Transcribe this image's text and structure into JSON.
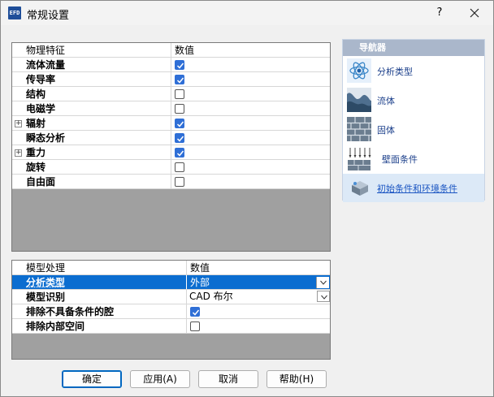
{
  "window": {
    "title": "常规设置",
    "app_icon_text": "EFD",
    "help_label": "?"
  },
  "physical_grid": {
    "col_feature": "物理特征",
    "col_value": "数值",
    "rows": [
      {
        "label": "流体流量",
        "checked": true,
        "expandable": false
      },
      {
        "label": "传导率",
        "checked": true,
        "expandable": false
      },
      {
        "label": "结构",
        "checked": false,
        "expandable": false
      },
      {
        "label": "电磁学",
        "checked": false,
        "expandable": false
      },
      {
        "label": "辐射",
        "checked": true,
        "expandable": true
      },
      {
        "label": "瞬态分析",
        "checked": true,
        "expandable": false
      },
      {
        "label": "重力",
        "checked": true,
        "expandable": true
      },
      {
        "label": "旋转",
        "checked": false,
        "expandable": false
      },
      {
        "label": "自由面",
        "checked": false,
        "expandable": false
      }
    ]
  },
  "model_grid": {
    "col_feature": "模型处理",
    "col_value": "数值",
    "analysis_type": {
      "label": "分析类型",
      "value": "外部"
    },
    "model_recognition": {
      "label": "模型识别",
      "value": "CAD 布尔"
    },
    "exclude_cavities": {
      "label": "排除不具备条件的腔",
      "checked": true
    },
    "exclude_internal": {
      "label": "排除内部空间",
      "checked": false
    }
  },
  "navigator": {
    "title": "导航器",
    "items": [
      {
        "label": "分析类型",
        "icon": "atom-icon"
      },
      {
        "label": "流体",
        "icon": "fluid-wave-icon"
      },
      {
        "label": "固体",
        "icon": "solid-brick-icon"
      },
      {
        "label": "壁面条件",
        "icon": "wall-condition-icon"
      },
      {
        "label": "初始条件和环境条件",
        "icon": "initial-conditions-icon"
      }
    ]
  },
  "buttons": {
    "ok": "确定",
    "apply": "应用(A)",
    "cancel": "取消",
    "help": "帮助(H)"
  },
  "colors": {
    "selection": "#0b6dd0",
    "checkbox_on": "#2f6fd6",
    "navigator_header": "#aab7cb"
  }
}
